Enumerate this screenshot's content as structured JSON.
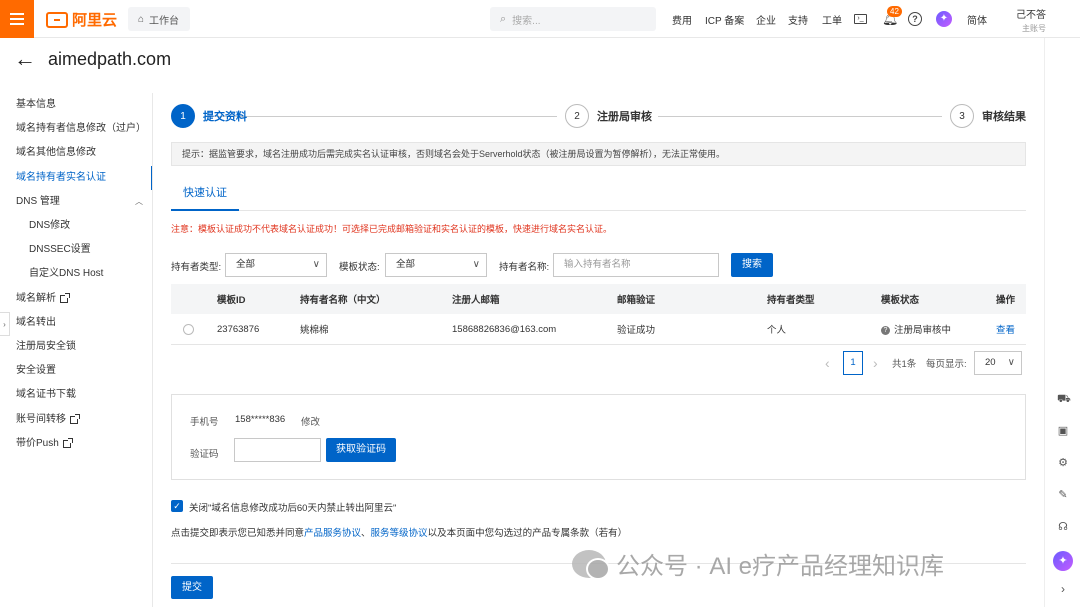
{
  "topbar": {
    "logo_text": "阿里云",
    "workbench": "工作台",
    "search_placeholder": "搜索...",
    "nav": [
      "费用",
      "ICP 备案",
      "企业",
      "支持",
      "工单"
    ],
    "notification_count": "42",
    "language": "简体",
    "user_name": "己不答",
    "user_role": "主账号",
    "accent": "#ff6a00"
  },
  "page": {
    "title": "aimedpath.com"
  },
  "sidebar": {
    "items": [
      {
        "label": "基本信息",
        "external": false
      },
      {
        "label": "域名持有者信息修改（过户）",
        "external": false
      },
      {
        "label": "域名其他信息修改",
        "external": false
      },
      {
        "label": "域名持有者实名认证",
        "external": false,
        "active": true
      },
      {
        "label": "DNS 管理",
        "external": false,
        "group": true
      },
      {
        "label": "DNS修改",
        "sub": true
      },
      {
        "label": "DNSSEC设置",
        "sub": true
      },
      {
        "label": "自定义DNS Host",
        "sub": true
      },
      {
        "label": "域名解析",
        "external": true
      },
      {
        "label": "域名转出",
        "external": false
      },
      {
        "label": "注册局安全锁",
        "external": false
      },
      {
        "label": "安全设置",
        "external": false
      },
      {
        "label": "域名证书下载",
        "external": false
      },
      {
        "label": "账号间转移",
        "external": true
      },
      {
        "label": "带价Push",
        "external": true
      }
    ]
  },
  "steps": [
    {
      "num": "1",
      "label": "提交资料",
      "active": true
    },
    {
      "num": "2",
      "label": "注册局审核",
      "active": false
    },
    {
      "num": "3",
      "label": "审核结果",
      "active": false
    }
  ],
  "notice": "提示：据监管要求，域名注册成功后需完成实名认证审核，否则域名会处于Serverhold状态（被注册局设置为暂停解析），无法正常使用。",
  "tab": "快速认证",
  "warning": "注意：模板认证成功不代表域名认证成功！可选择已完成邮箱验证和实名认证的模板，快速进行域名实名认证。",
  "filters": {
    "holder_type_label": "持有者类型:",
    "holder_type_value": "全部",
    "template_status_label": "模板状态:",
    "template_status_value": "全部",
    "holder_name_label": "持有者名称:",
    "holder_name_placeholder": "输入持有者名称",
    "search_button": "搜索"
  },
  "table": {
    "headers": [
      "模板ID",
      "持有者名称（中文）",
      "注册人邮箱",
      "邮箱验证",
      "持有者类型",
      "模板状态",
      "操作"
    ],
    "rows": [
      {
        "id": "23763876",
        "name": "姚棉棉",
        "email": "15868826836@163.com",
        "email_verify": "验证成功",
        "holder_type": "个人",
        "status": "注册局审核中",
        "action": "查看"
      }
    ]
  },
  "pagination": {
    "prev": "‹",
    "current": "1",
    "next": "›",
    "total": "共1条",
    "per_page_label": "每页显示:",
    "per_page_value": "20"
  },
  "verify": {
    "phone_label": "手机号",
    "phone_value": "158*****836",
    "modify": "修改",
    "code_label": "验证码",
    "get_code_button": "获取验证码"
  },
  "consent": "关闭\"域名信息修改成功后60天内禁止转出阿里云\"",
  "terms": {
    "prefix": "点击提交即表示您已知悉并同意",
    "link1": "产品服务协议",
    "sep": "、",
    "link2": "服务等级协议",
    "suffix": "以及本页面中您勾选过的产品专属条款（若有）"
  },
  "submit": "提交",
  "watermark": "公众号 · AI e疗产品经理知识库"
}
